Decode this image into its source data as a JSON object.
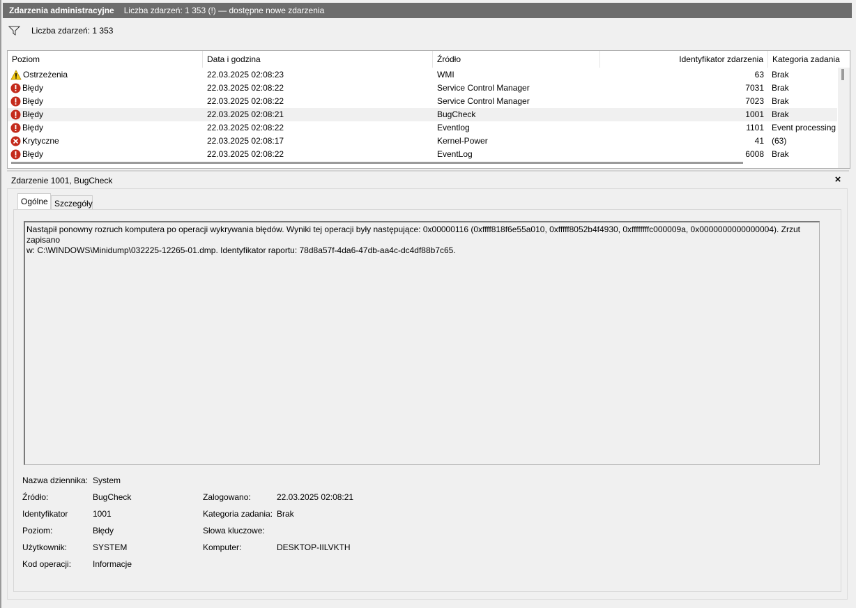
{
  "window": {
    "title": "Zdarzenia administracyjne",
    "subtitle": "Liczba zdarzeń: 1 353 (!) — dostępne nowe zdarzenia"
  },
  "filter": {
    "icon": "filter-icon",
    "text": "Liczba zdarzeń: 1 353"
  },
  "columns": {
    "level": "Poziom",
    "datetime": "Data i godzina",
    "source": "Źródło",
    "event_id": "Identyfikator zdarzenia",
    "category": "Kategoria zadania"
  },
  "events": [
    {
      "icon": "warning-icon",
      "level": "Ostrzeżenia",
      "datetime": "22.03.2025 02:08:23",
      "source": "WMI",
      "event_id": "63",
      "category": "Brak"
    },
    {
      "icon": "error-icon",
      "level": "Błędy",
      "datetime": "22.03.2025 02:08:22",
      "source": "Service Control Manager",
      "event_id": "7031",
      "category": "Brak"
    },
    {
      "icon": "error-icon",
      "level": "Błędy",
      "datetime": "22.03.2025 02:08:22",
      "source": "Service Control Manager",
      "event_id": "7023",
      "category": "Brak"
    },
    {
      "icon": "error-icon",
      "level": "Błędy",
      "datetime": "22.03.2025 02:08:21",
      "source": "BugCheck",
      "event_id": "1001",
      "category": "Brak"
    },
    {
      "icon": "error-icon",
      "level": "Błędy",
      "datetime": "22.03.2025 02:08:22",
      "source": "Eventlog",
      "event_id": "1101",
      "category": "Event processing"
    },
    {
      "icon": "critical-icon",
      "level": "Krytyczne",
      "datetime": "22.03.2025 02:08:17",
      "source": "Kernel-Power",
      "event_id": "41",
      "category": "(63)"
    },
    {
      "icon": "error-icon",
      "level": "Błędy",
      "datetime": "22.03.2025 02:08:22",
      "source": "EventLog",
      "event_id": "6008",
      "category": "Brak"
    }
  ],
  "detail": {
    "title": "Zdarzenie 1001, BugCheck",
    "close": "×",
    "tabs": [
      "Ogólne",
      "Szczegóły"
    ],
    "description_line1": "Nastąpił ponowny rozruch komputera po operacji wykrywania błędów. Wyniki tej operacji były następujące: 0x00000116 (0xffff818f6e55a010, 0xfffff8052b4f4930, 0xffffffffc000009a, 0x0000000000000004). Zrzut zapisano",
    "description_line2": "w: C:\\WINDOWS\\Minidump\\032225-12265-01.dmp. Identyfikator raportu: 78d8a57f-4da6-47db-aa4c-dc4df88b7c65.",
    "labels": {
      "log_name": "Nazwa dziennika:",
      "source": "Źródło:",
      "id": "Identyfikator",
      "level": "Poziom:",
      "user": "Użytkownik:",
      "opcode": "Kod operacji:",
      "logged": "Zalogowano:",
      "task_category": "Kategoria zadania:",
      "keywords": "Słowa kluczowe:",
      "computer": "Komputer:"
    },
    "values": {
      "log_name": "System",
      "source": "BugCheck",
      "id": "1001",
      "level": "Błędy",
      "user": "SYSTEM",
      "opcode": "Informacje",
      "logged": "22.03.2025 02:08:21",
      "task_category": "Brak",
      "keywords": "",
      "computer": "DESKTOP-IILVKTH"
    }
  },
  "colors": {
    "title_bar": "#6d6d6d",
    "error": "#c42b1c",
    "warning": "#f2c811",
    "selected_row": "#f0f0f0"
  }
}
